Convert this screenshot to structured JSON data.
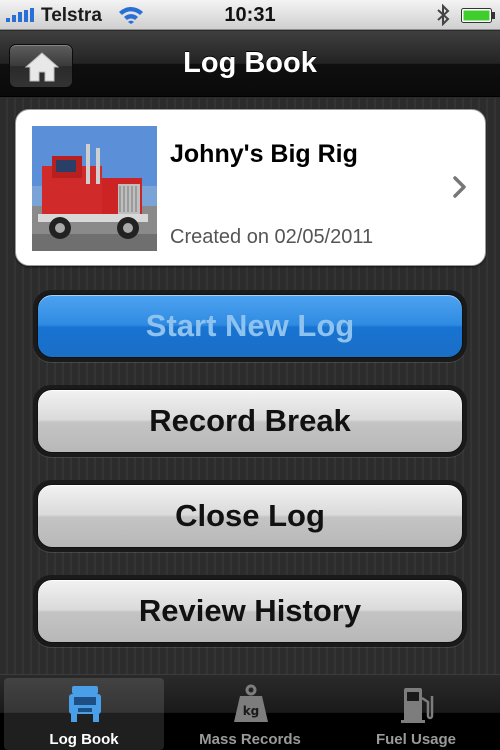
{
  "status_bar": {
    "carrier": "Telstra",
    "time": "10:31",
    "icons": [
      "signal-icon",
      "wifi-icon",
      "bluetooth-icon",
      "battery-icon"
    ]
  },
  "nav": {
    "title": "Log Book",
    "home_icon": "home-icon"
  },
  "vehicle": {
    "name": "Johny's Big Rig",
    "created": "Created on 02/05/2011",
    "photo": "red-truck-photo",
    "chevron_icon": "chevron-right-icon"
  },
  "actions": [
    {
      "label": "Start New Log",
      "style": "primary",
      "enabled": false
    },
    {
      "label": "Record Break",
      "style": "default",
      "enabled": true
    },
    {
      "label": "Close Log",
      "style": "default",
      "enabled": true
    },
    {
      "label": "Review History",
      "style": "default",
      "enabled": true
    }
  ],
  "tabs": [
    {
      "label": "Log Book",
      "icon": "truck-icon",
      "active": true
    },
    {
      "label": "Mass Records",
      "icon": "kg-weight-icon",
      "active": false
    },
    {
      "label": "Fuel Usage",
      "icon": "fuel-pump-icon",
      "active": false
    }
  ],
  "colors": {
    "primary_blue": "#2f8be2",
    "tab_active_icon": "#4aa0e8",
    "battery_green": "#3fce2e"
  }
}
